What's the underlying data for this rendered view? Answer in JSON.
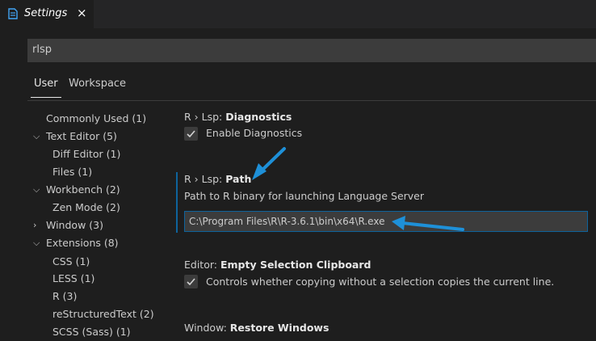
{
  "tab": {
    "title": "Settings",
    "close_glyph": "×",
    "icon": "settings-file-icon"
  },
  "search": {
    "value": "rlsp"
  },
  "scopes": {
    "user": "User",
    "workspace": "Workspace"
  },
  "toc": {
    "commonly_used": "Commonly Used (1)",
    "text_editor": "Text Editor (5)",
    "diff_editor": "Diff Editor (1)",
    "files": "Files (1)",
    "workbench": "Workbench (2)",
    "zen_mode": "Zen Mode (2)",
    "window": "Window (3)",
    "extensions": "Extensions (8)",
    "css": "CSS (1)",
    "less": "LESS (1)",
    "r": "R (3)",
    "restructuredtext": "reStructuredText (2)",
    "scss": "SCSS (Sass) (1)"
  },
  "settings": {
    "diagnostics": {
      "category": "R › Lsp: ",
      "name": "Diagnostics",
      "checkbox_label": "Enable Diagnostics",
      "checked": true
    },
    "path": {
      "category": "R › Lsp: ",
      "name": "Path",
      "description": "Path to R binary for launching Language Server",
      "value": "C:\\Program Files\\R\\R-3.6.1\\bin\\x64\\R.exe"
    },
    "clipboard": {
      "category": "Editor: ",
      "name": "Empty Selection Clipboard",
      "checkbox_label": "Controls whether copying without a selection copies the current line.",
      "checked": true
    },
    "restore": {
      "category": "Window: ",
      "name": "Restore Windows"
    }
  },
  "colors": {
    "accent": "#0e639c",
    "annotation_arrow": "#1e90d8",
    "background": "#1e1e1e"
  }
}
